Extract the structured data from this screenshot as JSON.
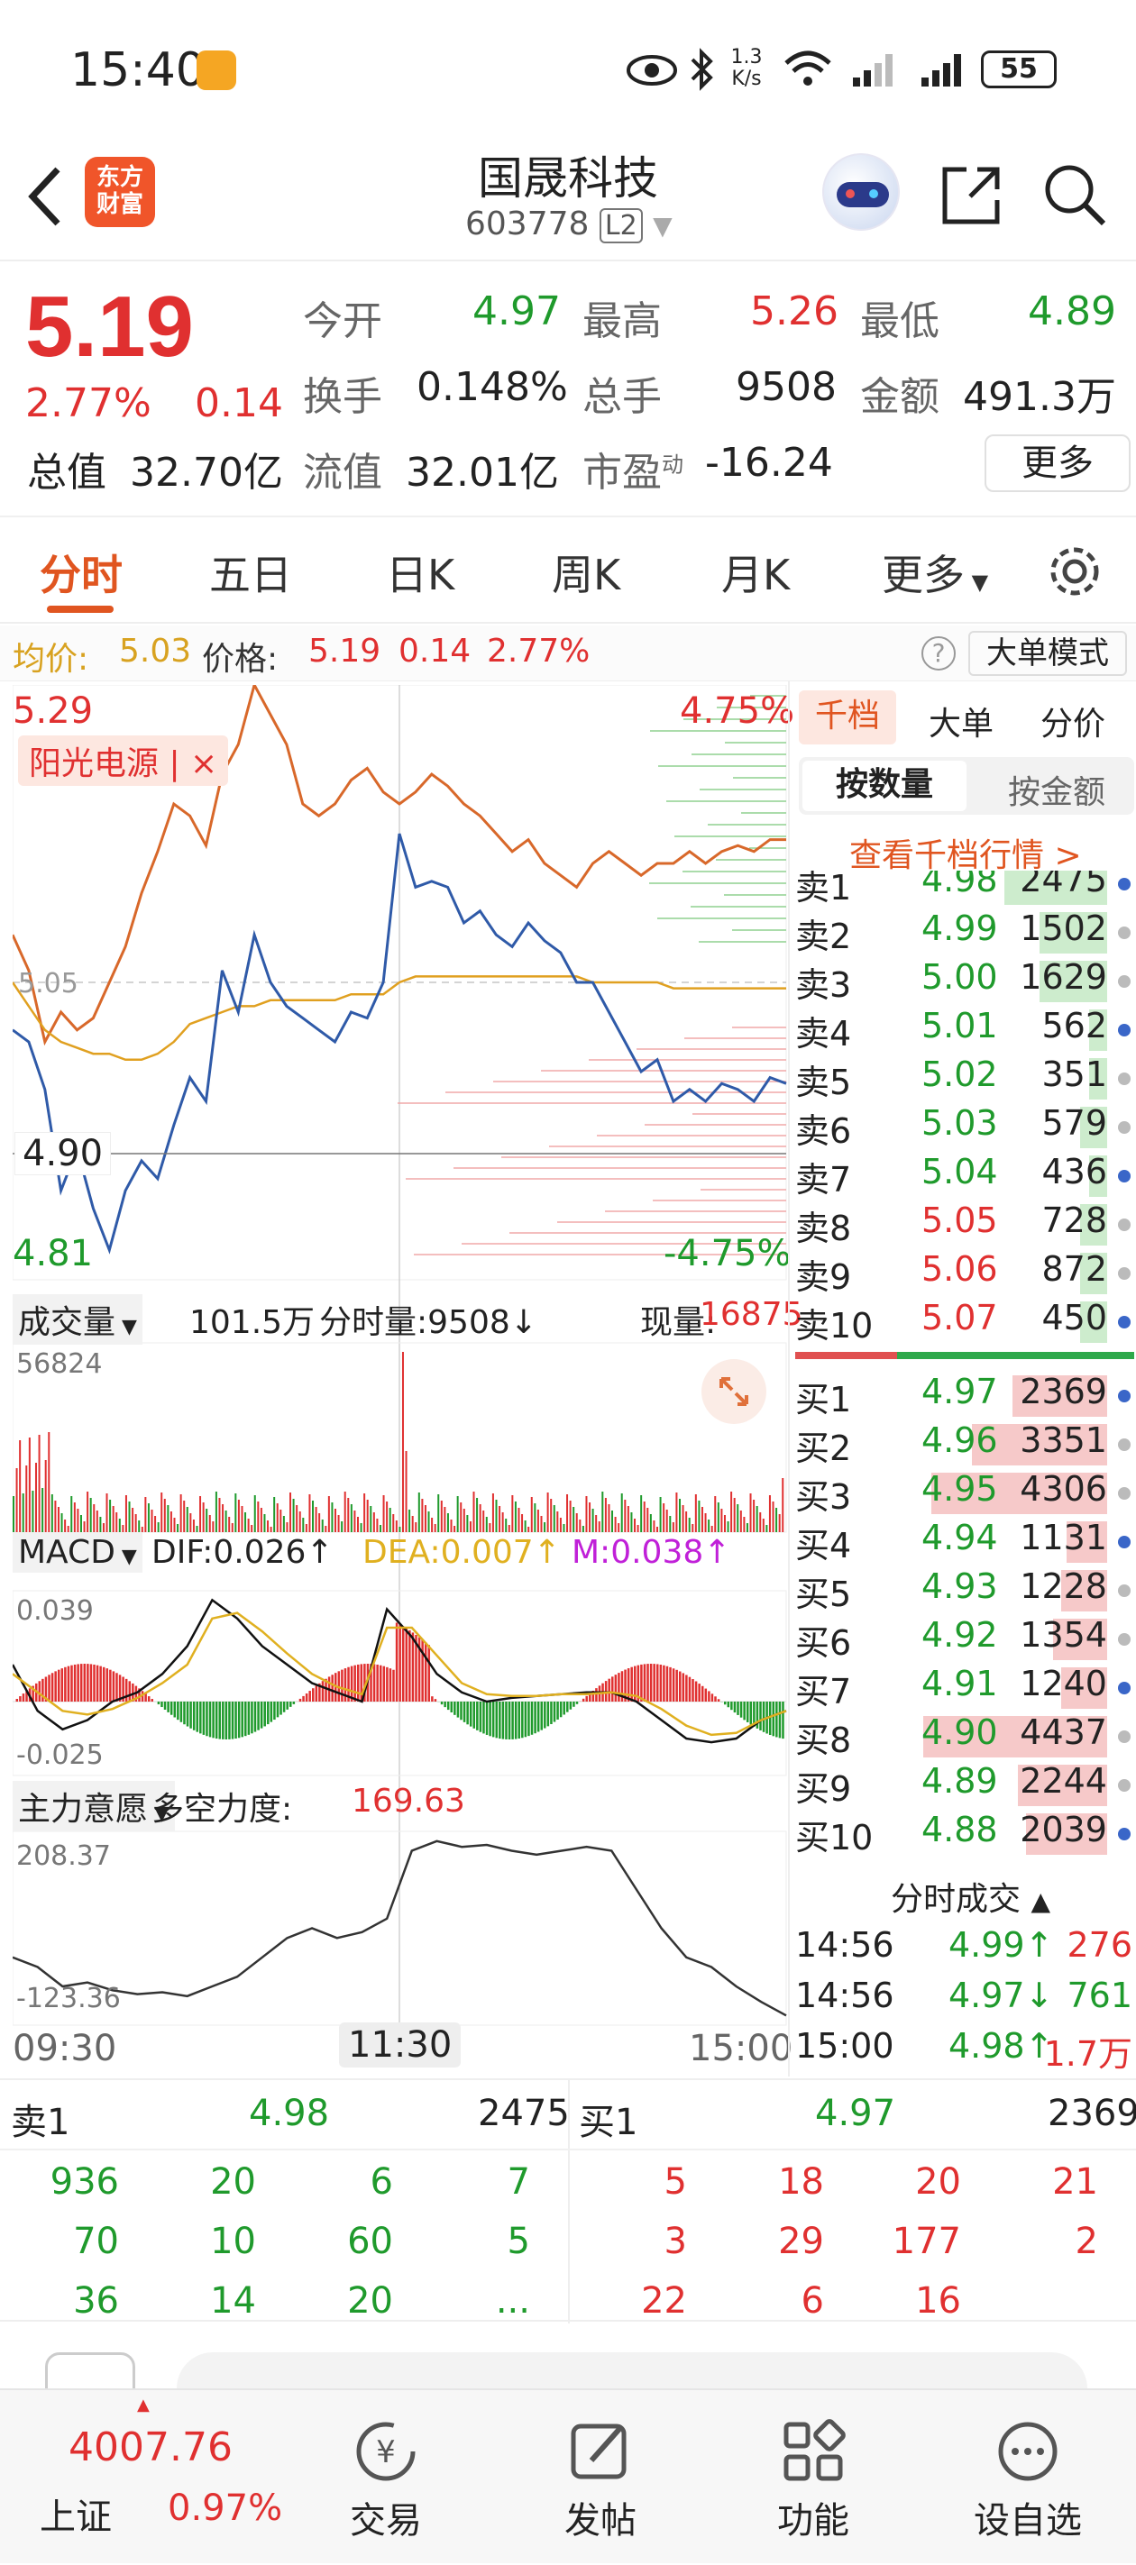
{
  "status": {
    "time": "15:40",
    "net_speed": "1.3\nK/s",
    "net_speed_top": "1.3",
    "net_speed_bottom": "K/s",
    "battery": "55"
  },
  "header": {
    "brand_line1": "东方",
    "brand_line2": "财富",
    "title": "国晟科技",
    "code": "603778",
    "level": "L2"
  },
  "quote": {
    "price": "5.19",
    "change_pct": "2.77%",
    "change": "0.14",
    "open_label": "今开",
    "open": "4.97",
    "high_label": "最高",
    "high": "5.26",
    "low_label": "最低",
    "low": "4.89",
    "turnover_label": "换手",
    "turnover": "0.148%",
    "volume_label": "总手",
    "volume": "9508",
    "amount_label": "金额",
    "amount": "491.3万",
    "mcap_label": "总值",
    "mcap": "32.70亿",
    "float_label": "流值",
    "float": "32.01亿",
    "pe_label": "市盈",
    "pe_sup": "动",
    "pe": "-16.24",
    "more": "更多"
  },
  "tabs": {
    "t1": "分时",
    "t2": "五日",
    "t3": "日K",
    "t4": "周K",
    "t5": "月K",
    "t6": "更多"
  },
  "infobar": {
    "avg_label": "均价:",
    "avg": "5.03",
    "price_label": "价格:",
    "price": "5.19",
    "change": "0.14",
    "pct": "2.77%",
    "mode": "大单模式"
  },
  "chart": {
    "ymax": "5.29",
    "ymin": "4.81",
    "pct_top": "4.75%",
    "pct_bottom": "-4.75%",
    "mid": "5.05",
    "cursor_price": "4.90",
    "concept": "阳光电源 | ×",
    "vol_label": "成交量",
    "vol_total": "101.5万",
    "fs_label": "分时量:9508↓",
    "cur_label": "现量:",
    "cur_vol": "16875",
    "vol_max": "56824",
    "macd_label": "MACD",
    "dif": "DIF:0.026↑",
    "dea": "DEA:0.007↑",
    "m": "M:0.038↑",
    "macd_max": "0.039",
    "macd_min": "-0.025",
    "zl_label": "主力意愿",
    "zl_title": "多空力度:",
    "zl_val": "169.63",
    "zl_max": "208.37",
    "zl_min": "-123.36",
    "time_start": "09:30",
    "time_mid": "11:30",
    "time_end": "15:00"
  },
  "orderbook": {
    "tab1": "千档",
    "tab2": "大单",
    "tab3": "分价",
    "btn1": "按数量",
    "btn2": "按金额",
    "link": "查看千档行情 >",
    "sells": [
      {
        "l": "卖10",
        "p": "5.07",
        "v": "450",
        "w": 0.1
      },
      {
        "l": "卖9",
        "p": "5.06",
        "v": "872",
        "w": 0.1
      },
      {
        "l": "卖8",
        "p": "5.05",
        "v": "728",
        "w": 0.1
      },
      {
        "l": "卖7",
        "p": "5.04",
        "v": "436",
        "w": 0.05
      },
      {
        "l": "卖6",
        "p": "5.03",
        "v": "579",
        "w": 0.1
      },
      {
        "l": "卖5",
        "p": "5.02",
        "v": "351",
        "w": 0.05
      },
      {
        "l": "卖4",
        "p": "5.01",
        "v": "562",
        "w": 0.05
      },
      {
        "l": "卖3",
        "p": "5.00",
        "v": "1629",
        "w": 0.25
      },
      {
        "l": "卖2",
        "p": "4.99",
        "v": "1502",
        "w": 0.25
      },
      {
        "l": "卖1",
        "p": "4.98",
        "v": "2475",
        "w": 0.38
      }
    ],
    "buys": [
      {
        "l": "买1",
        "p": "4.97",
        "v": "2369",
        "w": 0.35
      },
      {
        "l": "买2",
        "p": "4.96",
        "v": "3351",
        "w": 0.5
      },
      {
        "l": "买3",
        "p": "4.95",
        "v": "4306",
        "w": 0.65
      },
      {
        "l": "买4",
        "p": "4.94",
        "v": "1131",
        "w": 0.15
      },
      {
        "l": "买5",
        "p": "4.93",
        "v": "1228",
        "w": 0.17
      },
      {
        "l": "买6",
        "p": "4.92",
        "v": "1354",
        "w": 0.2
      },
      {
        "l": "买7",
        "p": "4.91",
        "v": "1240",
        "w": 0.17
      },
      {
        "l": "买8",
        "p": "4.90",
        "v": "4437",
        "w": 0.68
      },
      {
        "l": "买9",
        "p": "4.89",
        "v": "2244",
        "w": 0.33
      },
      {
        "l": "买10",
        "p": "4.88",
        "v": "2039",
        "w": 0.3
      }
    ],
    "trades_title": "分时成交",
    "trades": [
      {
        "t": "14:56",
        "p": "4.99↑",
        "v": "276"
      },
      {
        "t": "14:56",
        "p": "4.97↓",
        "v": "761"
      },
      {
        "t": "15:00",
        "p": "4.98↑",
        "v": "1.7万"
      }
    ]
  },
  "queue": {
    "sell_label": "卖1",
    "sell_price": "4.98",
    "sell_vol": "2475",
    "buy_label": "买1",
    "buy_price": "4.97",
    "buy_vol": "2369",
    "sell_rows": [
      [
        "936",
        "20",
        "6",
        "7"
      ],
      [
        "70",
        "10",
        "60",
        "5"
      ],
      [
        "36",
        "14",
        "20",
        "..."
      ]
    ],
    "buy_rows": [
      [
        "5",
        "18",
        "20",
        "21"
      ],
      [
        "3",
        "29",
        "177",
        "2"
      ],
      [
        "22",
        "6",
        "16",
        ""
      ]
    ]
  },
  "nav": {
    "index_val": "4007.76",
    "index_name": "上证",
    "index_pct": "0.97%",
    "n1": "交易",
    "n2": "发帖",
    "n3": "功能",
    "n4": "设自选"
  },
  "colors": {
    "up": "#e03030",
    "down": "#1f9a2c",
    "price_line": "#2f5aa8",
    "avg_line": "#e0a020",
    "concept_line": "#d8682a"
  }
}
